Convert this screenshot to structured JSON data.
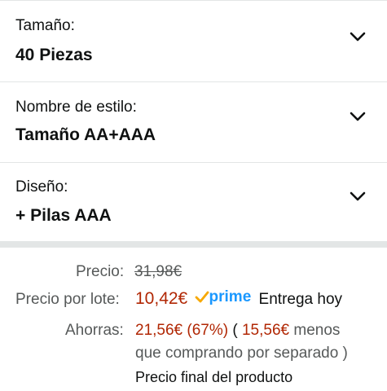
{
  "variations": [
    {
      "label": "Tamaño:",
      "value": "40 Piezas"
    },
    {
      "label": "Nombre de estilo:",
      "value": "Tamaño AA+AAA"
    },
    {
      "label": "Diseño:",
      "value": "+ Pilas AAA"
    }
  ],
  "pricing": {
    "price_label": "Precio:",
    "original_price": "31,98€",
    "lot_label": "Precio por lote:",
    "lot_price": "10,42€",
    "prime_label": "prime",
    "delivery": "Entrega hoy",
    "savings_label": "Ahorras:",
    "savings_amount": "21,56€ (67%)",
    "savings_paren_open": "(",
    "savings_compare": "15,56€",
    "savings_less": "menos",
    "savings_line2": "que comprando por separado )",
    "final_note": "Precio final del producto"
  },
  "colors": {
    "deal": "#b12704",
    "prime": "#1a98ff",
    "muted": "#565959"
  },
  "icons": {
    "chevron": "chevron-down-icon",
    "prime_check": "prime-check-icon"
  }
}
